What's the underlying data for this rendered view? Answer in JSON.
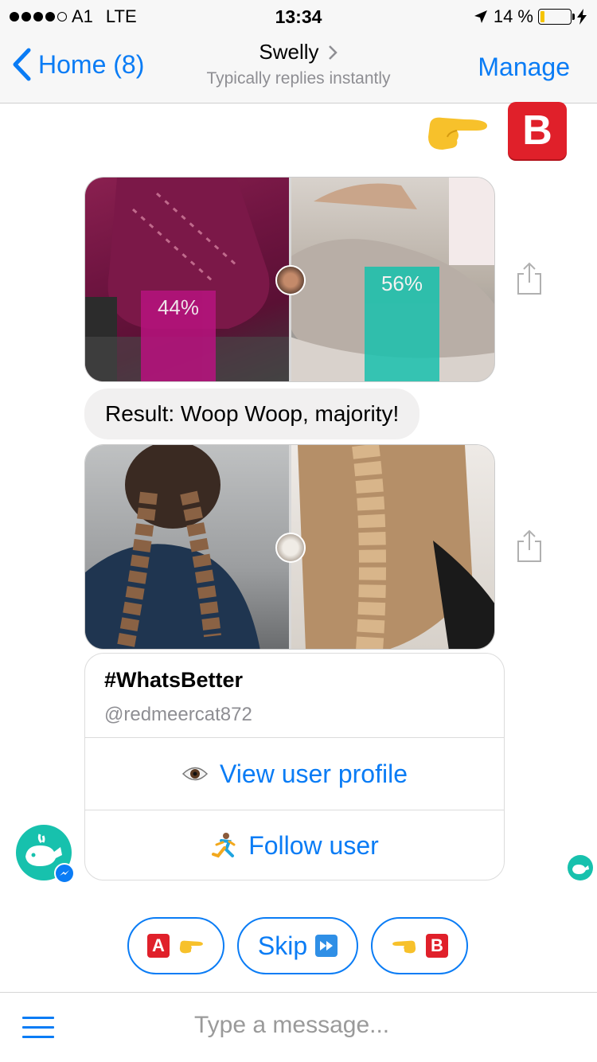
{
  "status_bar": {
    "carrier": "A1",
    "network": "LTE",
    "time": "13:34",
    "battery": "14 %",
    "battery_level": 0.14
  },
  "nav": {
    "back_label": "Home (8)",
    "title": "Swelly",
    "subtitle": "Typically replies instantly",
    "manage_label": "Manage",
    "accent_color": "#0a7cf5"
  },
  "sent_message": {
    "icons": [
      "point-right-icon",
      "b-button-icon"
    ],
    "letter": "B"
  },
  "poll_1": {
    "left_percent": "44%",
    "right_percent": "56%",
    "left_value": 0.44,
    "right_value": 0.56,
    "left_bar_color": "#b5137d",
    "right_bar_color": "#17c1ad"
  },
  "result_text": "Result: Woop Woop, majority!",
  "card": {
    "title": "#WhatsBetter",
    "username": "@redmeercat872",
    "view_profile_label": "View user profile",
    "follow_label": "Follow user"
  },
  "quick_replies": {
    "a_letter": "A",
    "skip_label": "Skip",
    "b_letter": "B"
  },
  "composer": {
    "placeholder": "Type a message..."
  }
}
